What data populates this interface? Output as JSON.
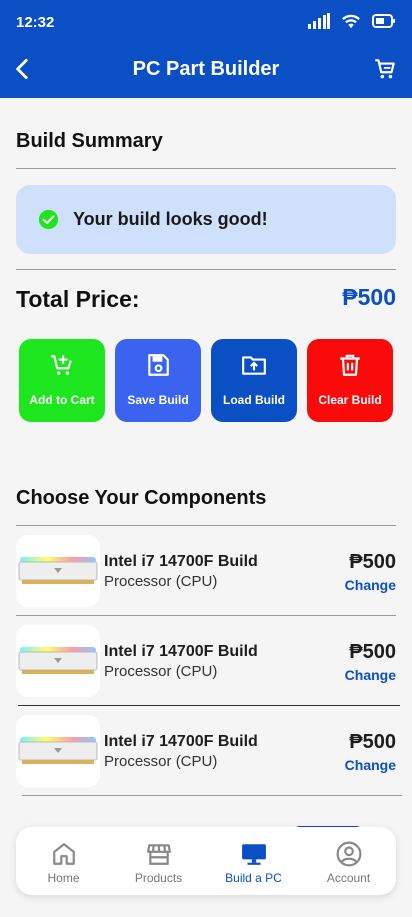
{
  "status_bar": {
    "time": "12:32"
  },
  "app_bar": {
    "title": "PC Part Builder"
  },
  "summary": {
    "heading": "Build Summary",
    "status_message": "Your build looks good!",
    "total_label": "Total Price:",
    "total_value": "₱500"
  },
  "actions": [
    {
      "label": "Add to Cart",
      "color": "#1ee61e"
    },
    {
      "label": "Save Build",
      "color": "#3a64ef"
    },
    {
      "label": "Load Build",
      "color": "#0a4fc4"
    },
    {
      "label": "Clear Build",
      "color": "#fa0a0a"
    }
  ],
  "components": {
    "heading": "Choose Your Components",
    "items": [
      {
        "name": "Intel i7 14700F Build",
        "category": "Processor (CPU)",
        "price": "₱500",
        "action": "Change"
      },
      {
        "name": "Intel i7 14700F Build",
        "category": "Processor (CPU)",
        "price": "₱500",
        "action": "Change"
      },
      {
        "name": "Intel i7 14700F Build",
        "category": "Processor (CPU)",
        "price": "₱500",
        "action": "Change"
      }
    ]
  },
  "bottom_nav": {
    "items": [
      {
        "label": "Home",
        "icon": "home-icon"
      },
      {
        "label": "Products",
        "icon": "store-icon"
      },
      {
        "label": "Build a PC",
        "icon": "monitor-icon",
        "active": true
      },
      {
        "label": "Account",
        "icon": "account-icon"
      }
    ]
  },
  "colors": {
    "primary": "#0a4fc4",
    "banner": "#cfe0fb",
    "success": "#1ee61e",
    "danger": "#fa0a0a"
  }
}
